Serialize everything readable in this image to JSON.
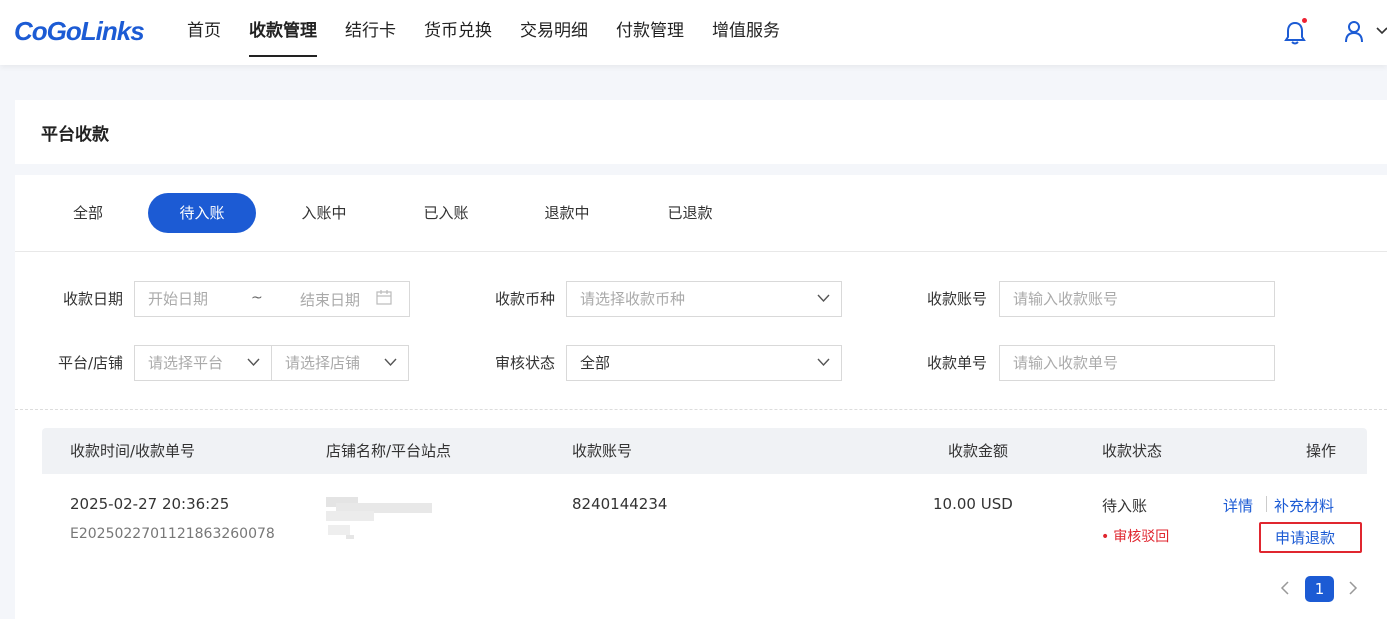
{
  "brand": {
    "logo_text": "CoGoLinks",
    "accent": "#1c5bd4",
    "danger": "#e0262f"
  },
  "nav": {
    "items": [
      {
        "label": "首页"
      },
      {
        "label": "收款管理",
        "active": true
      },
      {
        "label": "结行卡"
      },
      {
        "label": "货币兑换"
      },
      {
        "label": "交易明细"
      },
      {
        "label": "付款管理"
      },
      {
        "label": "增值服务"
      }
    ],
    "icons": [
      "bell-icon",
      "user-icon",
      "chevron-down-icon"
    ]
  },
  "page": {
    "title": "平台收款"
  },
  "tabs": [
    {
      "label": "全部"
    },
    {
      "label": "待入账",
      "active": true
    },
    {
      "label": "入账中"
    },
    {
      "label": "已入账"
    },
    {
      "label": "退款中"
    },
    {
      "label": "已退款"
    }
  ],
  "filters": {
    "date_label": "收款日期",
    "date_start_placeholder": "开始日期",
    "date_sep": "~",
    "date_end_placeholder": "结束日期",
    "currency_label": "收款币种",
    "currency_placeholder": "请选择收款币种",
    "account_label": "收款账号",
    "account_placeholder": "请输入收款账号",
    "platform_label": "平台/店铺",
    "platform_placeholder": "请选择平台",
    "shop_placeholder": "请选择店铺",
    "review_label": "审核状态",
    "review_value": "全部",
    "order_label": "收款单号",
    "order_placeholder": "请输入收款单号"
  },
  "table": {
    "headers": {
      "time_order": "收款时间/收款单号",
      "shop_site": "店铺名称/平台站点",
      "account": "收款账号",
      "amount": "收款金额",
      "status": "收款状态",
      "actions": "操作"
    },
    "rows": [
      {
        "time": "2025-02-27 20:36:25",
        "order_no": "E20250227011218632600​78",
        "account": "8240144234",
        "amount": "10.00 USD",
        "status": "待入账",
        "review_note": "审核驳回",
        "action_detail": "详情",
        "action_supplement": "补充材料",
        "action_refund": "申请退款"
      }
    ]
  },
  "pagination": {
    "current": "1"
  }
}
